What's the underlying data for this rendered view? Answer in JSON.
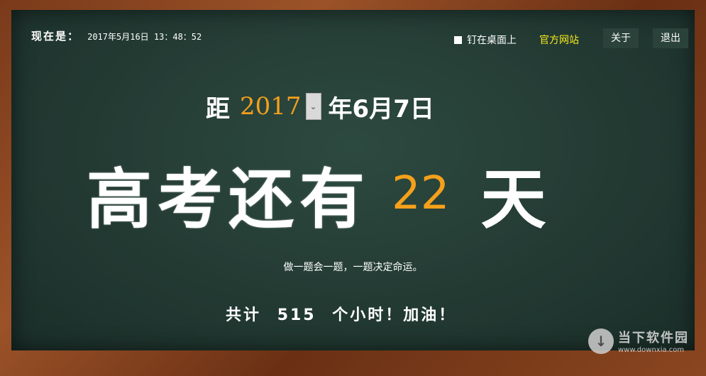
{
  "clock": {
    "label": "现在是：",
    "value": "2017年5月16日 13：48：52"
  },
  "toolbar": {
    "pin_label": "钉在桌面上",
    "site_label": "官方网站",
    "about_label": "关于",
    "exit_label": "退出"
  },
  "target": {
    "prefix": "距",
    "year": "2017",
    "dropdown_icon": "chevron-down-icon",
    "suffix": "年6月7日"
  },
  "headline": {
    "text": "高考还有",
    "days": "22",
    "unit": "天"
  },
  "motto": "做一题会一题，一题决定命运。",
  "hours": {
    "prefix": "共计",
    "value": "515",
    "suffix": "个小时！加油！"
  },
  "watermark": {
    "title": "当下软件园",
    "url": "www.downxia.com"
  },
  "colors": {
    "board": "#233a33",
    "accent": "#f5a01b",
    "link": "#f7ea1c",
    "frame": "#8a4620"
  }
}
